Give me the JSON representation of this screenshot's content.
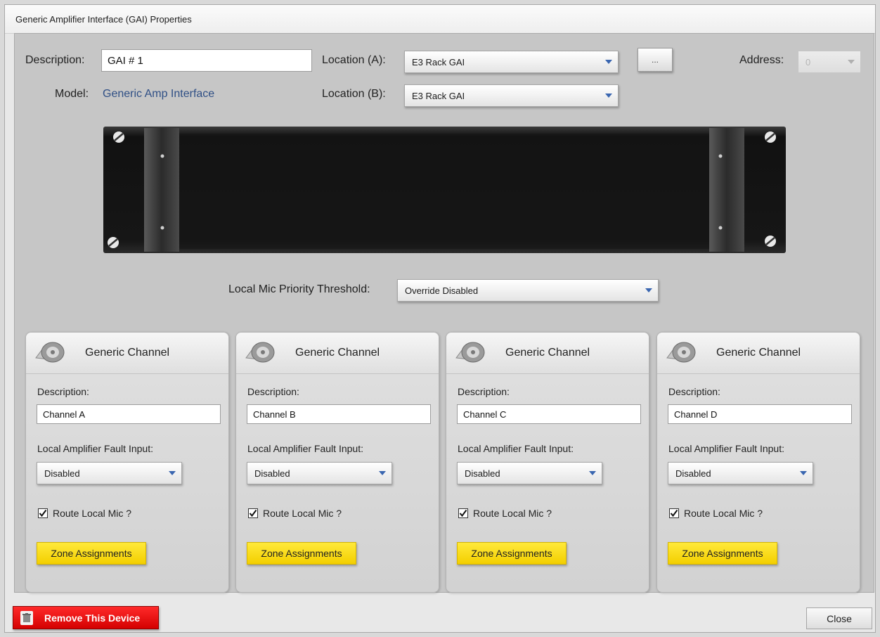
{
  "window": {
    "title": "Generic Amplifier Interface (GAI) Properties"
  },
  "device": {
    "description_label": "Description:",
    "description_value": "GAI # 1",
    "model_label": "Model:",
    "model_value": "Generic Amp Interface",
    "location_a_label": "Location (A):",
    "location_a_value": "E3 Rack GAI",
    "location_b_label": "Location (B):",
    "location_b_value": "E3 Rack GAI",
    "ellipsis_label": "...",
    "address_label": "Address:",
    "address_value": "0"
  },
  "threshold": {
    "label": "Local Mic Priority Threshold:",
    "value": "Override Disabled"
  },
  "channels": [
    {
      "title": "Generic Channel",
      "description_label": "Description:",
      "description_value": "Channel A",
      "fault_label": "Local Amplifier Fault Input:",
      "fault_value": "Disabled",
      "route_label": "Route Local Mic ?",
      "route_checked": true,
      "zone_button": "Zone Assignments"
    },
    {
      "title": "Generic Channel",
      "description_label": "Description:",
      "description_value": "Channel B",
      "fault_label": "Local Amplifier Fault Input:",
      "fault_value": "Disabled",
      "route_label": "Route Local Mic ?",
      "route_checked": true,
      "zone_button": "Zone Assignments"
    },
    {
      "title": "Generic Channel",
      "description_label": "Description:",
      "description_value": "Channel C",
      "fault_label": "Local Amplifier Fault Input:",
      "fault_value": "Disabled",
      "route_label": "Route Local Mic ?",
      "route_checked": true,
      "zone_button": "Zone Assignments"
    },
    {
      "title": "Generic Channel",
      "description_label": "Description:",
      "description_value": "Channel D",
      "fault_label": "Local Amplifier Fault Input:",
      "fault_value": "Disabled",
      "route_label": "Route Local Mic ?",
      "route_checked": true,
      "zone_button": "Zone Assignments"
    }
  ],
  "footer": {
    "remove_label": "Remove This Device",
    "close_label": "Close"
  },
  "colors": {
    "zone_button": "#f7d90f",
    "remove_button": "#e00000",
    "dropdown_arrow": "#3a66b0",
    "model_text": "#2f4f85"
  },
  "icons": [
    "speaker-icon",
    "checkmark-icon",
    "trash-icon",
    "chevron-down-icon",
    "screw-icon"
  ]
}
